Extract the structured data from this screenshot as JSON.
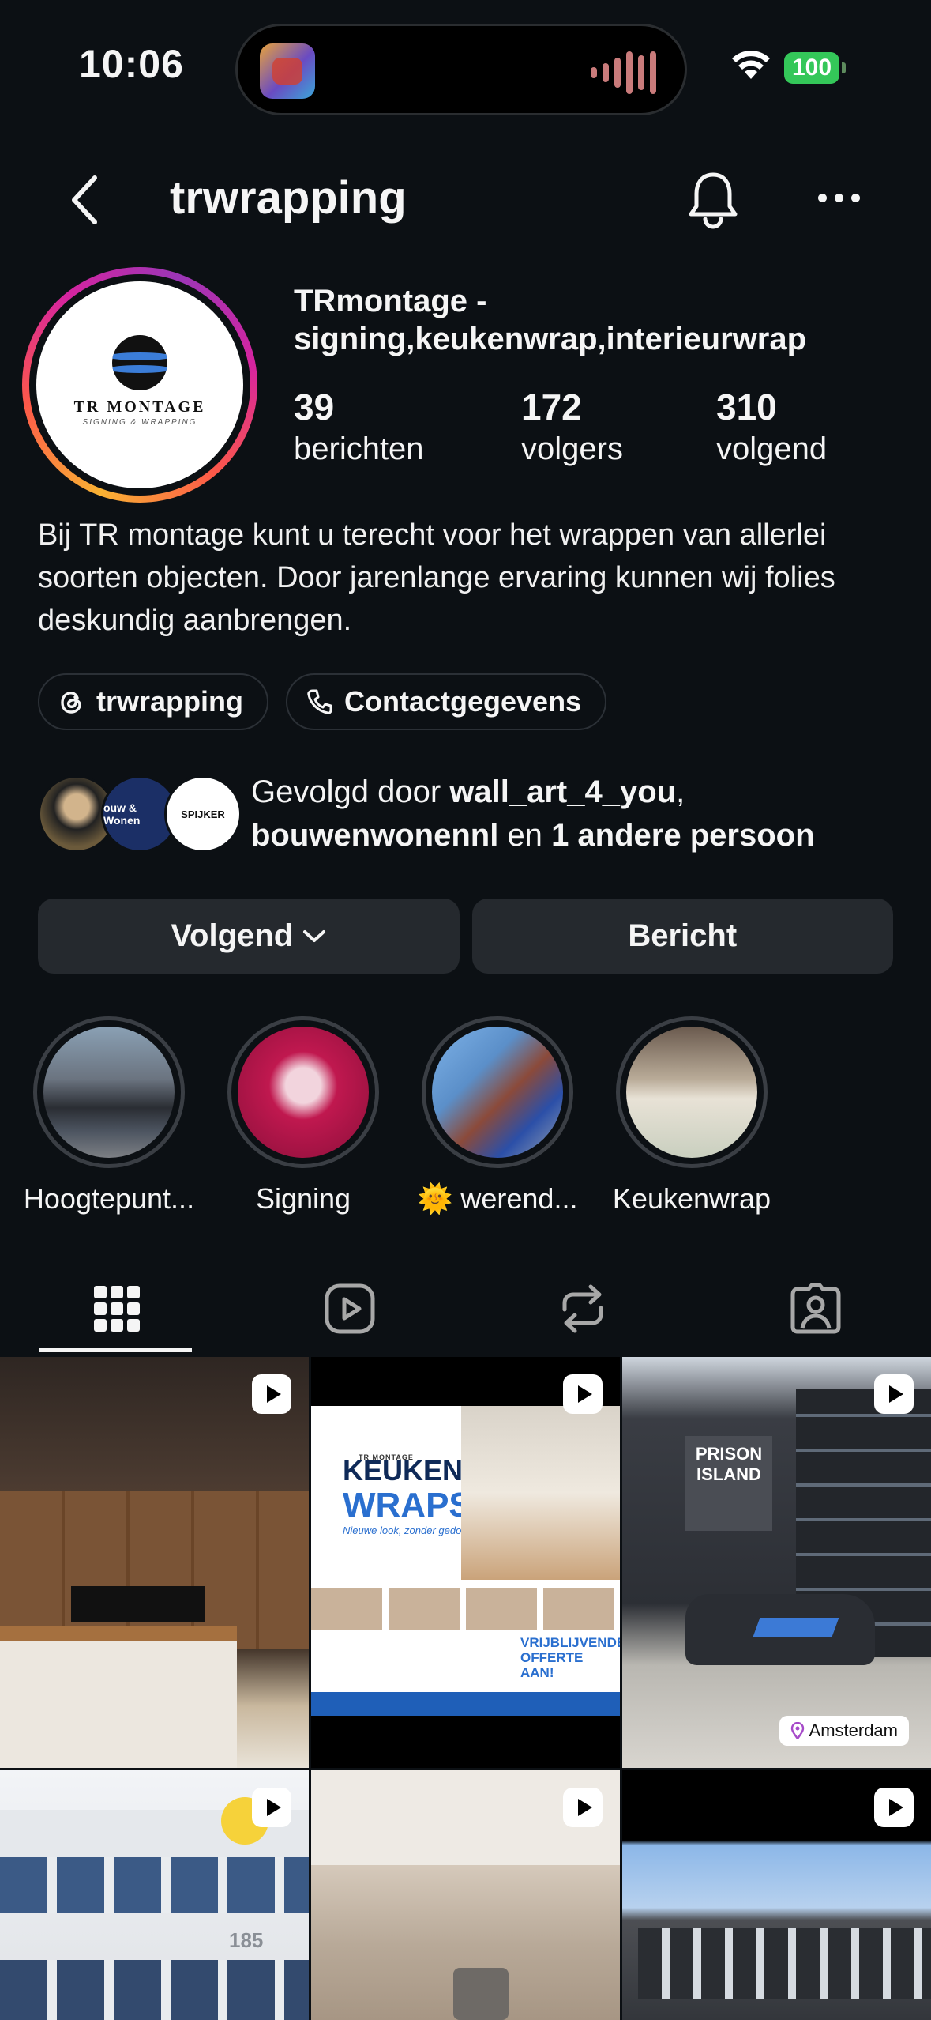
{
  "status_bar": {
    "time": "10:06",
    "battery": "100"
  },
  "header": {
    "username": "trwrapping"
  },
  "profile": {
    "full_name": "TRmontage - signing,keukenwrap,interieurwrap",
    "avatar_text": "TR MONTAGE",
    "avatar_subtext": "SIGNING & WRAPPING",
    "stats": [
      {
        "value": "39",
        "label": "berichten"
      },
      {
        "value": "172",
        "label": "volgers"
      },
      {
        "value": "310",
        "label": "volgend"
      }
    ],
    "bio": "Bij TR montage kunt u terecht voor het wrappen van allerlei soorten objecten. Door jarenlange ervaring kunnen wij folies deskundig aanbrengen.",
    "threads_chip": "trwrapping",
    "contact_chip": "Contactgegevens"
  },
  "followed_by": {
    "prefix": "Gevolgd door",
    "user1": "wall_art_4_you",
    "comma": ",",
    "user2": "bouwenwonennl",
    "conj": "en",
    "others": "1 andere persoon",
    "avatar2_text": "ouw & Wonen",
    "avatar3_text": "SPIJKER"
  },
  "actions": {
    "follow": "Volgend",
    "message": "Bericht"
  },
  "highlights": [
    {
      "label": "Hoogtepunt..."
    },
    {
      "label": "Signing"
    },
    {
      "label": "🌞 werend..."
    },
    {
      "label": "Keukenwrap"
    }
  ],
  "posts": {
    "keuken_title_1": "KEUKEN",
    "keuken_title_2": "WRAPS",
    "keuken_sub": "Nieuwe look, zonder gedoe!",
    "keuken_offer": "VRIJBLIJVENDE OFFERTE AAN!",
    "keuken_logo": "TR MONTAGE",
    "prison_sign": "PRISON ISLAND",
    "location": "Amsterdam",
    "building_number": "185"
  },
  "colors": {
    "background": "#0c1014",
    "button": "#25292e",
    "battery": "#34c759"
  }
}
